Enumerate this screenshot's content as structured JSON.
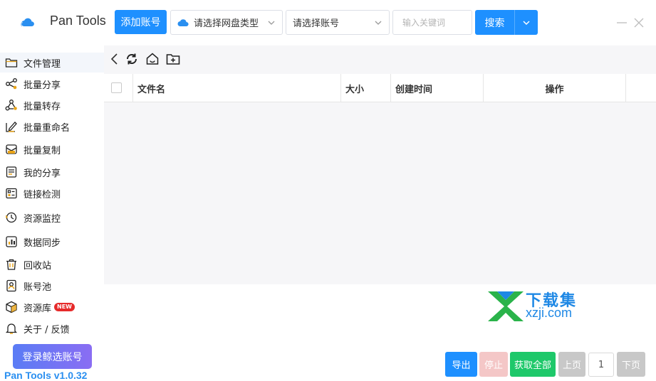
{
  "app": {
    "title": "Pan Tools",
    "version": "Pan Tools v1.0.32"
  },
  "header": {
    "add_account_label": "添加账号",
    "drive_type_placeholder": "请选择网盘类型",
    "account_placeholder": "请选择账号",
    "keyword_placeholder": "输入关键词",
    "search_label": "搜索"
  },
  "sidebar": {
    "items": [
      {
        "label": "文件管理",
        "icon": "folder-icon",
        "active": true
      },
      {
        "label": "批量分享",
        "icon": "share-icon"
      },
      {
        "label": "批量转存",
        "icon": "transfer-icon"
      },
      {
        "label": "批量重命名",
        "icon": "rename-icon"
      },
      {
        "label": "批量复制",
        "icon": "copy-icon"
      },
      {
        "label": "我的分享",
        "icon": "my-share-icon"
      },
      {
        "label": "链接检测",
        "icon": "link-check-icon"
      },
      {
        "label": "资源监控",
        "icon": "monitor-icon"
      },
      {
        "label": "数据同步",
        "icon": "sync-icon"
      },
      {
        "label": "回收站",
        "icon": "trash-icon"
      },
      {
        "label": "账号池",
        "icon": "account-pool-icon"
      },
      {
        "label": "资源库",
        "icon": "library-icon",
        "badge": "NEW"
      },
      {
        "label": "关于 / 反馈",
        "icon": "bell-icon"
      }
    ],
    "login_label": "登录鲸选账号"
  },
  "file_table": {
    "columns": [
      "文件名",
      "大小",
      "创建时间",
      "操作"
    ],
    "rows": []
  },
  "footer": {
    "export_label": "导出",
    "stop_label": "停止",
    "get_all_label": "获取全部",
    "prev_label": "上页",
    "page": "1",
    "next_label": "下页"
  },
  "watermark": {
    "cn": "下载集",
    "en": "xzji.com"
  },
  "colors": {
    "primary": "#1e90ff",
    "success": "#1ec86a",
    "disabled": "#c8c8c8",
    "stop": "#f4c7c7"
  }
}
